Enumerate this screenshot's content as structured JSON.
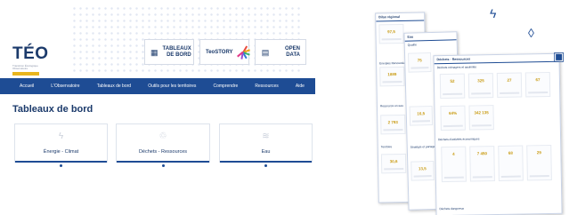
{
  "site": {
    "logo": {
      "name": "TÉO",
      "tagline": "Transition Écologique Observatoire"
    },
    "header_buttons": [
      {
        "label_line1": "TABLEAUX",
        "label_line2": "DE BORD",
        "icon": "grid-icon"
      },
      {
        "label_line1": "TeoSTORY",
        "label_line2": "",
        "icon": "starburst-icon"
      },
      {
        "label_line1": "OPEN",
        "label_line2": "DATA",
        "icon": "database-icon"
      }
    ],
    "nav": [
      "Accueil",
      "L'Observatoire",
      "Tableaux de bord",
      "Outils pour les territoires",
      "Comprendre",
      "Ressources",
      "Aide"
    ],
    "page_title": "Tableaux de bord",
    "cards": [
      {
        "label": "Énergie - Climat",
        "icon": "lightning-icon"
      },
      {
        "label": "Déchets - Ressources",
        "icon": "recycle-icon"
      },
      {
        "label": "Eau",
        "icon": "water-icon"
      }
    ]
  },
  "sheets": {
    "sheet1": {
      "header": "Bilan régional",
      "section1": "Energies Renouvelables",
      "section2": "Ressource en eau",
      "section3": "Territoire",
      "values": [
        "97,5",
        "1889",
        "2 793",
        "30,6"
      ]
    },
    "sheet2": {
      "header": "Eau",
      "section1": "Qualité",
      "section2": "Stratégie et partage",
      "values": [
        "75",
        "16,5",
        "13,5"
      ]
    },
    "sheet3": {
      "header": "Déchets - Ressources",
      "section1": "Déchets ménagers et assimilés",
      "section2": "Déchets d'activités économiques",
      "section3": "Déchets dangereux",
      "values": [
        "52",
        "325",
        "27",
        "67",
        "64%",
        "342 135",
        "4",
        "7 450",
        "68",
        "29"
      ]
    }
  },
  "colors": {
    "brand_blue": "#1e4c94",
    "navy": "#1b3a6b",
    "gold": "#e9b51d"
  }
}
